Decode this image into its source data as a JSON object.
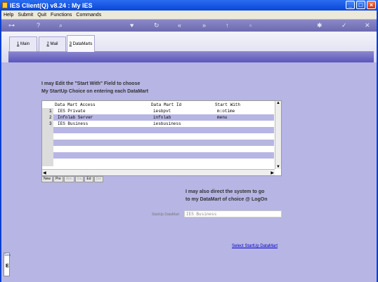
{
  "window": {
    "title": "IES Client(Q) v8.24 : My IES"
  },
  "menu": [
    "Help",
    "Submit",
    "Quit",
    "Functions",
    "Commands"
  ],
  "toolbar_icons": [
    "key-icon",
    "help-icon",
    "search-icon",
    "heart-icon",
    "refresh-icon",
    "rewind-icon",
    "forward-icon",
    "upload-icon",
    "copy-icon",
    "settings-icon",
    "check-icon",
    "close-icon"
  ],
  "tabs": [
    {
      "num": "1",
      "label": "Main"
    },
    {
      "num": "2",
      "label": "Mail"
    },
    {
      "num": "3",
      "label": "DataMarts"
    }
  ],
  "intro": {
    "line1": "I may Edit the \"Start With\" Field to choose",
    "line2": "My StartUp Choice on entering each DataMart"
  },
  "grid": {
    "columns": [
      "Data Mart Access",
      "Data Mart Id",
      "Start With"
    ],
    "rows": [
      {
        "n": "1",
        "access": "IES Private",
        "id": "iesbpvt",
        "start": "m:otime"
      },
      {
        "n": "2",
        "access": "Infolab Server",
        "id": "infolab",
        "start": "menu"
      },
      {
        "n": "3",
        "access": "IES Business",
        "id": "iesbusiness",
        "start": ""
      }
    ],
    "buttons": [
      "New",
      "Pre",
      "Abo",
      "Ins",
      "Ed",
      "Del"
    ]
  },
  "second": {
    "line1": "I may also direct the system to go",
    "line2": "to my DataMart of choice @ LogOn"
  },
  "startup": {
    "label": "StartUp DataMart",
    "value": "IES Business"
  },
  "link": "Select StartUp DataMart",
  "side_tab_label": "Sea"
}
